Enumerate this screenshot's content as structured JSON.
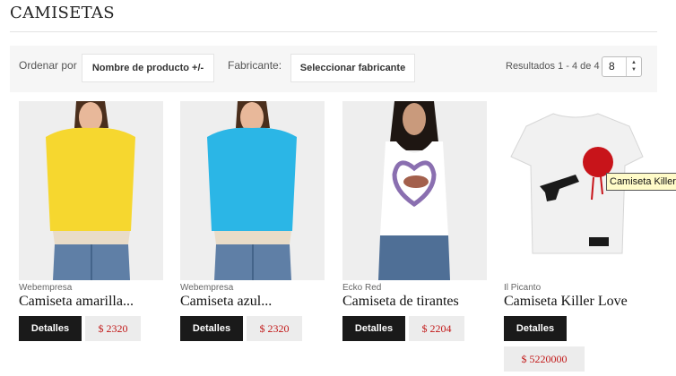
{
  "page": {
    "title": "CAMISETAS"
  },
  "toolbar": {
    "order_label": "Ordenar por",
    "order_value": "Nombre de producto +/-",
    "manufacturer_label": "Fabricante:",
    "manufacturer_value": "Seleccionar fabricante",
    "results_text": "Resultados 1 - 4 de 4",
    "per_page": "8"
  },
  "products": [
    {
      "manufacturer": "Webempresa",
      "name": "Camiseta amarilla...",
      "details_label": "Detalles",
      "price": "$ 2320",
      "shirt_color": "#f6d72f"
    },
    {
      "manufacturer": "Webempresa",
      "name": "Camiseta azul...",
      "details_label": "Detalles",
      "price": "$ 2320",
      "shirt_color": "#2bb6e6"
    },
    {
      "manufacturer": "Ecko Red",
      "name": "Camiseta de tirantes",
      "details_label": "Detalles",
      "price": "$ 2204",
      "shirt_color": "#ffffff"
    },
    {
      "manufacturer": "Il Picanto",
      "name": "Camiseta Killer Love",
      "details_label": "Detalles",
      "price": "$ 5220000",
      "shirt_color": "#ffffff"
    }
  ],
  "tooltip": {
    "text": "Camiseta Killer Love"
  }
}
